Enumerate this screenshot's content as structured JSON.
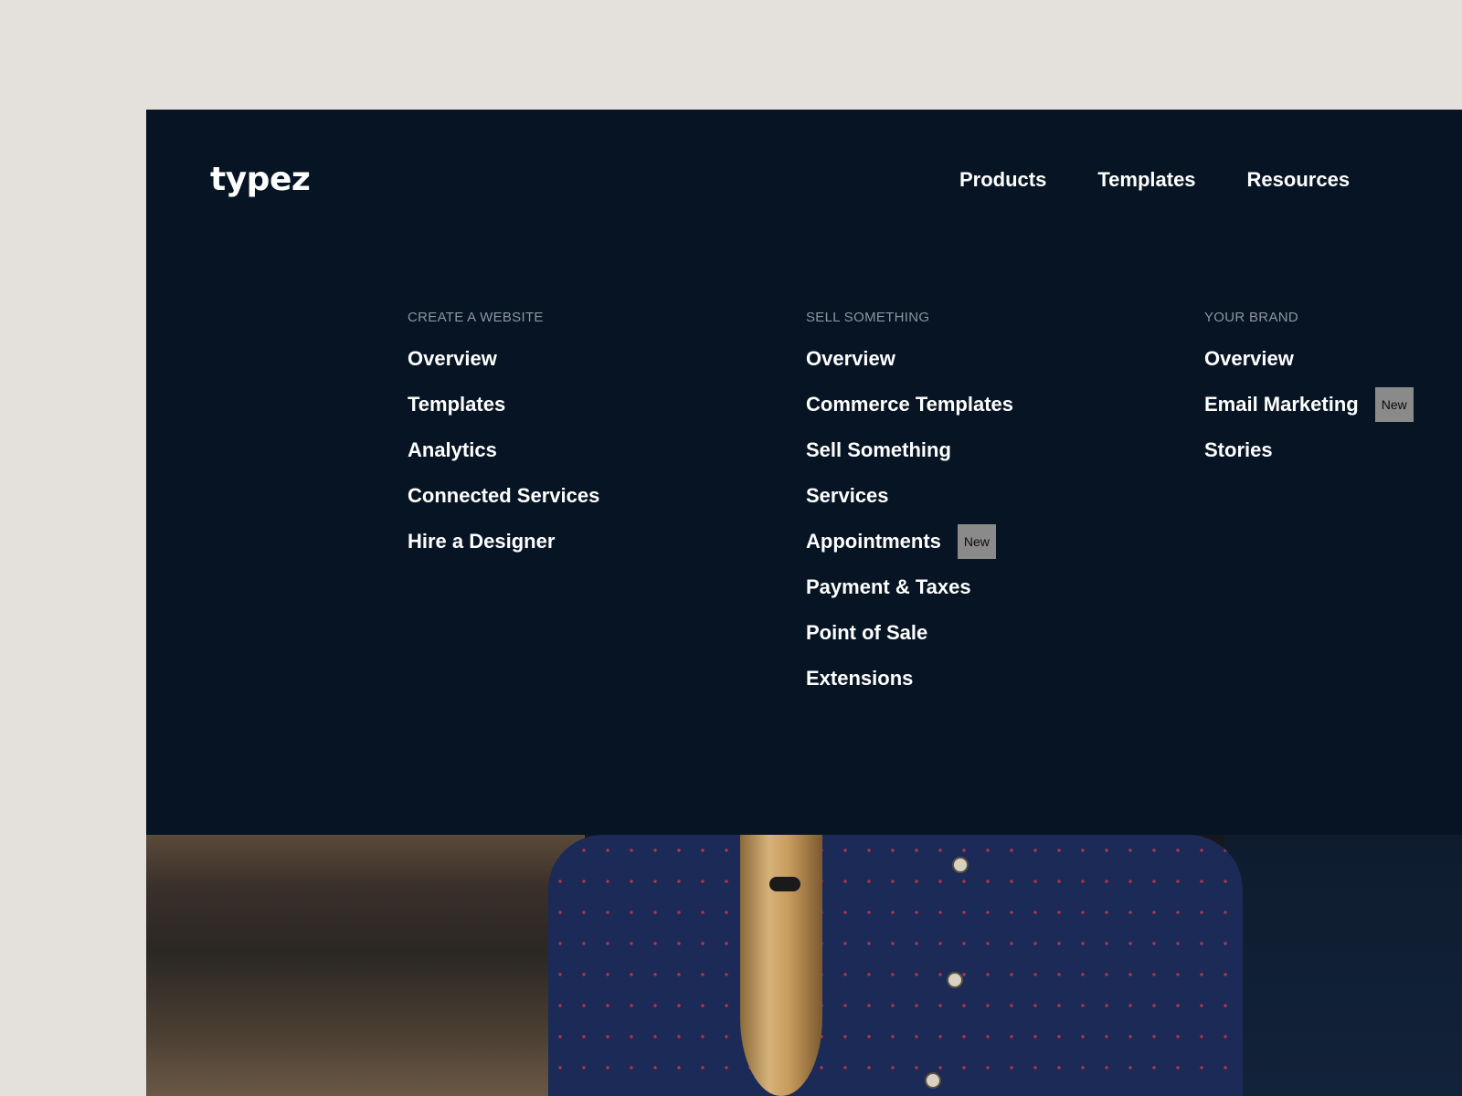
{
  "brand": {
    "logo_text": "typez"
  },
  "nav": {
    "items": [
      {
        "label": "Products"
      },
      {
        "label": "Templates"
      },
      {
        "label": "Resources"
      }
    ]
  },
  "mega_menu": {
    "columns": [
      {
        "heading": "CREATE A WEBSITE",
        "items": [
          {
            "label": "Overview"
          },
          {
            "label": "Templates"
          },
          {
            "label": "Analytics"
          },
          {
            "label": "Connected Services"
          },
          {
            "label": "Hire a Designer"
          }
        ]
      },
      {
        "heading": "SELL SOMETHING",
        "items": [
          {
            "label": "Overview"
          },
          {
            "label": "Commerce Templates"
          },
          {
            "label": "Sell Something"
          },
          {
            "label": "Services"
          },
          {
            "label": "Appointments",
            "badge": "New"
          },
          {
            "label": "Payment & Taxes"
          },
          {
            "label": "Point of Sale"
          },
          {
            "label": "Extensions"
          }
        ]
      },
      {
        "heading": "YOUR BRAND",
        "items": [
          {
            "label": "Overview"
          },
          {
            "label": "Email Marketing",
            "badge": "New"
          },
          {
            "label": "Stories"
          }
        ]
      }
    ]
  },
  "colors": {
    "page_background": "#e4e1dc",
    "menu_background": "#061423",
    "heading_text": "#8e959e",
    "badge_background": "#8a8a8a"
  }
}
